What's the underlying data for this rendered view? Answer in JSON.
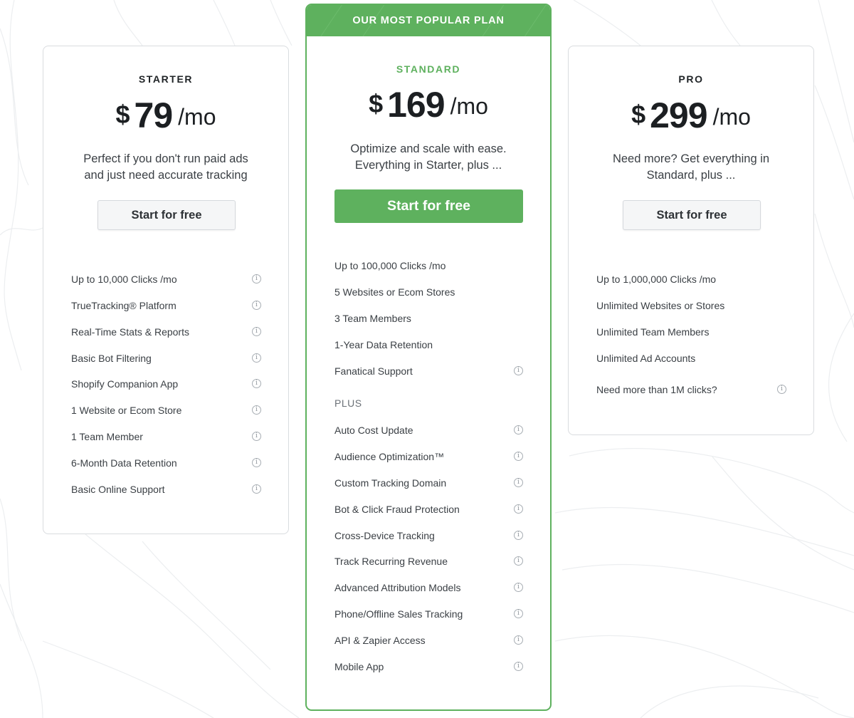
{
  "colors": {
    "accent": "#5eb15e",
    "border": "#d9dcdf",
    "button_bg": "#f5f6f7",
    "text": "#2b2f33"
  },
  "icons": {
    "info": "info-icon"
  },
  "starter": {
    "name": "STARTER",
    "price": {
      "currency": "$",
      "amount": "79",
      "period": "/mo"
    },
    "description_lines": [
      "Perfect if you don't run paid ads",
      "and just need accurate tracking"
    ],
    "button": "Start for free",
    "features": [
      "Up to 10,000 Clicks /mo",
      "TrueTracking® Platform",
      "Real-Time Stats & Reports",
      "Basic Bot Filtering",
      "Shopify Companion App",
      "1 Website or Ecom Store",
      "1 Team Member",
      "6-Month Data Retention",
      "Basic Online Support"
    ]
  },
  "standard": {
    "banner": "OUR MOST POPULAR PLAN",
    "name": "STANDARD",
    "price": {
      "currency": "$",
      "amount": "169",
      "period": "/mo"
    },
    "description_lines": [
      "Optimize and scale with ease.",
      "Everything in Starter, plus ..."
    ],
    "button": "Start for free",
    "features": [
      "Up to 100,000 Clicks /mo",
      "5 Websites or Ecom Stores",
      "3 Team Members",
      "1-Year Data Retention",
      "Fanatical Support"
    ],
    "plus_label": "PLUS",
    "plus_features": [
      "Auto Cost Update",
      "Audience Optimization™",
      "Custom Tracking Domain",
      "Bot & Click Fraud Protection",
      "Cross-Device Tracking",
      "Track Recurring Revenue",
      "Advanced Attribution Models",
      "Phone/Offline Sales Tracking",
      "API & Zapier Access",
      "Mobile App"
    ]
  },
  "pro": {
    "name": "PRO",
    "price": {
      "currency": "$",
      "amount": "299",
      "period": "/mo"
    },
    "description_lines": [
      "Need more? Get everything in",
      "Standard, plus ..."
    ],
    "button": "Start for free",
    "features": [
      "Up to 1,000,000 Clicks /mo",
      "Unlimited Websites or Stores",
      "Unlimited Team Members",
      "Unlimited Ad Accounts"
    ],
    "extra": "Need more than 1M clicks?"
  }
}
